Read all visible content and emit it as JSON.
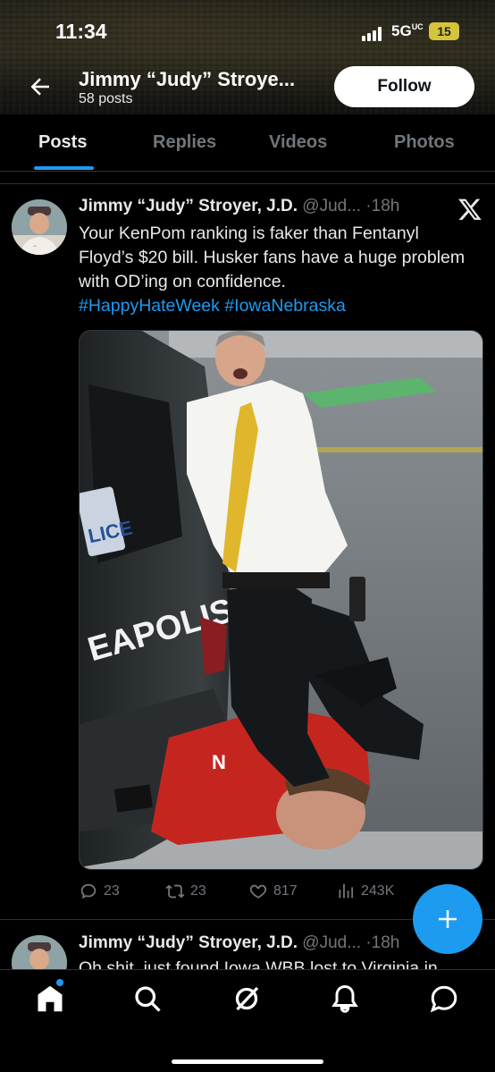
{
  "status_bar": {
    "time": "11:34",
    "network": "5G",
    "network_suffix": "UC",
    "battery": "15"
  },
  "header": {
    "profile_name": "Jimmy “Judy” Stroye...",
    "post_count": "58 posts",
    "follow_label": "Follow"
  },
  "tabs": [
    {
      "label": "Posts",
      "active": true
    },
    {
      "label": "Replies",
      "active": false
    },
    {
      "label": "Videos",
      "active": false
    },
    {
      "label": "Photos",
      "active": false
    }
  ],
  "tweet": {
    "display_name": "Jimmy “Judy” Stroyer, J.D.",
    "handle": "@Jud...",
    "separator": "·",
    "time": "18h",
    "text": "Your KenPom ranking is faker than Fentanyl Floyd’s $20 bill. Husker fans have a huge problem with OD’ing on confidence.",
    "hashtags": [
      "#HappyHateWeek",
      "#IowaNebraska"
    ],
    "media": {
      "vehicle_text": "EAPOLIS",
      "plate_text": "LICE",
      "shirt_logo": "N"
    },
    "stats": {
      "replies": "23",
      "reposts": "23",
      "likes": "817",
      "views": "243K"
    }
  },
  "next_tweet": {
    "display_name": "Jimmy “Judy” Stroyer, J.D.",
    "handle": "@Jud...",
    "separator": "·",
    "time": "18h",
    "text_partial": "Oh shit, just found Iowa WBB lost to Virginia in"
  },
  "icons": {
    "back": "back-arrow-icon",
    "brand": "x-logo-icon",
    "compose": "plus-icon",
    "nav": [
      "home-icon",
      "search-icon",
      "grok-icon",
      "notifications-icon",
      "messages-icon"
    ]
  },
  "colors": {
    "accent": "#1d9bf0",
    "muted": "#71767b",
    "text": "#e7e9ea",
    "background": "#000000"
  }
}
